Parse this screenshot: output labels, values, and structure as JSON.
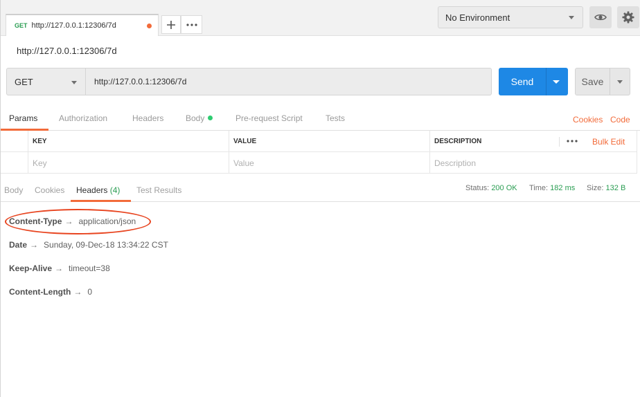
{
  "request_tab": {
    "method": "GET",
    "url": "http://127.0.0.1:12306/7d"
  },
  "environment": {
    "selected": "No Environment"
  },
  "request_title": "http://127.0.0.1:12306/7d",
  "request": {
    "method": "GET",
    "url": "http://127.0.0.1:12306/7d",
    "send_label": "Send",
    "save_label": "Save"
  },
  "request_tabs": {
    "params": "Params",
    "authorization": "Authorization",
    "headers": "Headers",
    "body": "Body",
    "prerequest": "Pre-request Script",
    "tests": "Tests",
    "cookies": "Cookies",
    "code": "Code"
  },
  "params_table": {
    "key_header": "KEY",
    "value_header": "VALUE",
    "description_header": "DESCRIPTION",
    "bulk_edit": "Bulk Edit",
    "key_placeholder": "Key",
    "value_placeholder": "Value",
    "description_placeholder": "Description"
  },
  "response_tabs": {
    "body": "Body",
    "cookies": "Cookies",
    "headers": "Headers",
    "headers_count": "(4)",
    "test_results": "Test Results"
  },
  "response_meta": {
    "status_label": "Status:",
    "status_value": "200 OK",
    "time_label": "Time:",
    "time_value": "182 ms",
    "size_label": "Size:",
    "size_value": "132 B"
  },
  "response_headers": [
    {
      "key": "Content-Type",
      "value": "application/json"
    },
    {
      "key": "Date",
      "value": "Sunday, 09-Dec-18 13:34:22 CST"
    },
    {
      "key": "Keep-Alive",
      "value": "timeout=38"
    },
    {
      "key": "Content-Length",
      "value": "0"
    }
  ],
  "arrow_glyph": "→",
  "colors": {
    "accent": "#f26b3a",
    "send_blue": "#1e88e5",
    "success_green": "#2a9d52",
    "annotation_red": "#e8441f"
  },
  "icons": {
    "add_tab": "plus-icon",
    "more": "ellipsis-icon",
    "env_dropdown": "chevron-down-icon",
    "quick_look": "eye-icon",
    "settings": "gear-icon"
  }
}
